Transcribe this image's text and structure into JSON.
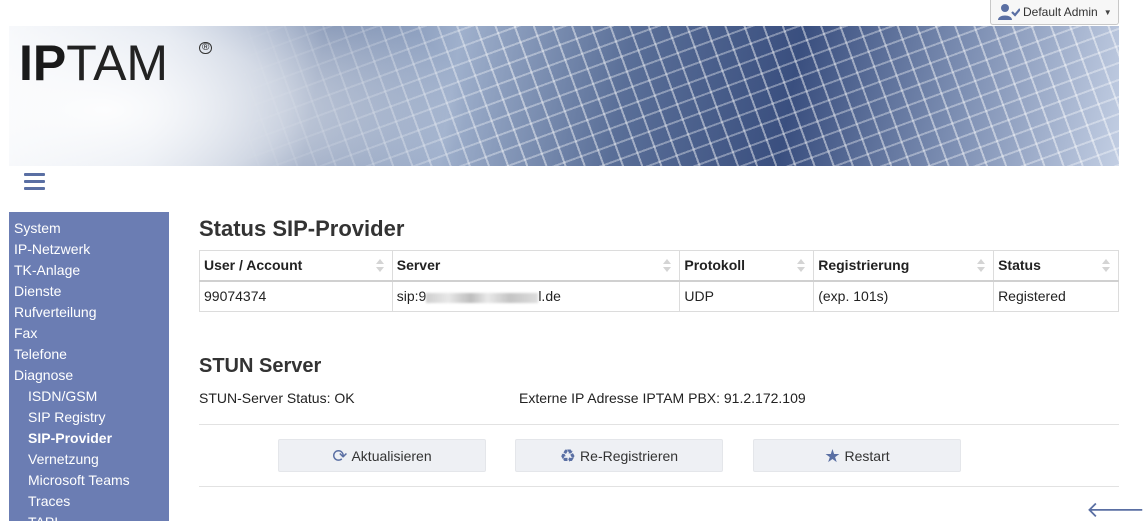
{
  "user": {
    "name": "Default Admin"
  },
  "banner": {
    "logo_bold": "IP",
    "logo_rest": "TAM",
    "logo_mark": "®"
  },
  "sidebar": {
    "items": [
      {
        "label": "System",
        "sub": false,
        "active": false
      },
      {
        "label": "IP-Netzwerk",
        "sub": false,
        "active": false
      },
      {
        "label": "TK-Anlage",
        "sub": false,
        "active": false
      },
      {
        "label": "Dienste",
        "sub": false,
        "active": false
      },
      {
        "label": "Rufverteilung",
        "sub": false,
        "active": false
      },
      {
        "label": "Fax",
        "sub": false,
        "active": false
      },
      {
        "label": "Telefone",
        "sub": false,
        "active": false
      },
      {
        "label": "Diagnose",
        "sub": false,
        "active": false
      },
      {
        "label": "ISDN/GSM",
        "sub": true,
        "active": false
      },
      {
        "label": "SIP Registry",
        "sub": true,
        "active": false
      },
      {
        "label": "SIP-Provider",
        "sub": true,
        "active": true
      },
      {
        "label": "Vernetzung",
        "sub": true,
        "active": false
      },
      {
        "label": "Microsoft Teams",
        "sub": true,
        "active": false
      },
      {
        "label": "Traces",
        "sub": true,
        "active": false
      },
      {
        "label": "TAPI",
        "sub": true,
        "active": false
      }
    ]
  },
  "main": {
    "title": "Status SIP-Provider",
    "table": {
      "columns": [
        "User / Account",
        "Server",
        "Protokoll",
        "Registrierung",
        "Status"
      ],
      "rows": [
        {
          "account": "99074374",
          "server_prefix": "sip:9",
          "server_suffix": "l.de",
          "protocol": "UDP",
          "registration": "(exp. 101s)",
          "status": "Registered"
        }
      ]
    },
    "stun": {
      "title": "STUN Server",
      "status": "STUN-Server Status: OK",
      "external_ip": "Externe IP Adresse IPTAM PBX: 91.2.172.109"
    },
    "buttons": {
      "refresh": "Aktualisieren",
      "reregister": "Re-Registrieren",
      "restart": "Restart"
    }
  },
  "colors": {
    "accent": "#6b7db3",
    "icon": "#5a6fa3"
  }
}
